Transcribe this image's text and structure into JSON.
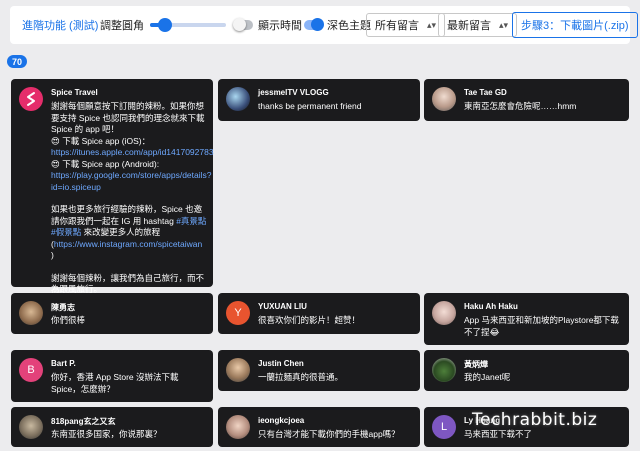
{
  "toolbar": {
    "advanced_link": "進階功能 (測試)",
    "radius_label": "調整圓角",
    "radius_value": 0.2,
    "show_time_label": "顯示時間",
    "show_time_on": false,
    "dark_theme_label": "深色主題",
    "dark_theme_on": true,
    "filter_select": "所有留言",
    "sort_select": "最新留言",
    "step_button": "步驟3：下載圖片(.zip)"
  },
  "comment_count": "70",
  "colors": {
    "accent": "#1a73e8",
    "card_bg": "#1b1b1d",
    "page_bg": "#ececee",
    "link": "#6ea8fe"
  },
  "watermark": "Techrabbit.biz",
  "comments": [
    {
      "name": "Spice Travel",
      "avatar_icon": "spice-logo-icon",
      "lines": [
        "謝謝每個願意按下訂閱的辣粉。如果你想要支持 Spice 也認同我們的理念就來下載 Spice 的 app 吧！",
        "😍 下載 Spice app (iOS)：",
        "https://itunes.apple.com/app/id1417092783",
        "😍 下載 Spice app (Android):",
        "https://play.google.com/store/apps/details?id=io.spiceup",
        "如果也更多旅行經驗的辣粉，Spice 也邀請你跟我們一起在 IG 用 hashtag",
        "#真景點 #假景點",
        "來改變更多人的旅程",
        "(",
        "https://www.instagram.com/spicetaiwan",
        " )",
        "謝謝每個辣粉，讓我們為自己旅行，而不為跟風旅行。"
      ]
    },
    {
      "name": "jessmelTV VLOGG",
      "avatar_icon": "photo-avatar-icon",
      "text": "thanks be permanent friend"
    },
    {
      "name": "Tae Tae GD",
      "avatar_icon": "photo-avatar-icon",
      "text": "東南亞怎麼會危險呢……hmm"
    },
    {
      "name": "陳勇志",
      "avatar_icon": "photo-avatar-icon",
      "text": "你們很棒"
    },
    {
      "name": "YUXUAN LIU",
      "avatar_letter": "Y",
      "avatar_color": "#e8542f",
      "text": "很喜欢你们的影片！超赞！"
    },
    {
      "name": "Haku Ah Haku",
      "avatar_icon": "photo-avatar-icon",
      "text": "App 马来西亚和新加坡的Playstore都下载不了捏😂"
    },
    {
      "name": "Bart P.",
      "avatar_letter": "B",
      "avatar_color": "#e3427a",
      "text": "你好，香港 App Store 沒辦法下載 Spice，怎麼辦？"
    },
    {
      "name": "Justin Chen",
      "avatar_icon": "photo-avatar-icon",
      "text": "一蘭拉麵真的很普通。"
    },
    {
      "name": "黃炳燁",
      "avatar_icon": "photo-avatar-icon",
      "text": "我的Janet呢"
    },
    {
      "name": "818pang玄之又玄",
      "avatar_icon": "photo-avatar-icon",
      "text": "东南亚很多国家，你说那裏？"
    },
    {
      "name": "ieongkcjoea",
      "avatar_icon": "photo-avatar-icon",
      "text": "只有台灣才能下載你們的手機app嗎？"
    },
    {
      "name": "Ly Hoang",
      "avatar_letter": "L",
      "avatar_color": "#7e57c2",
      "text": "马来西亚下载不了"
    }
  ]
}
